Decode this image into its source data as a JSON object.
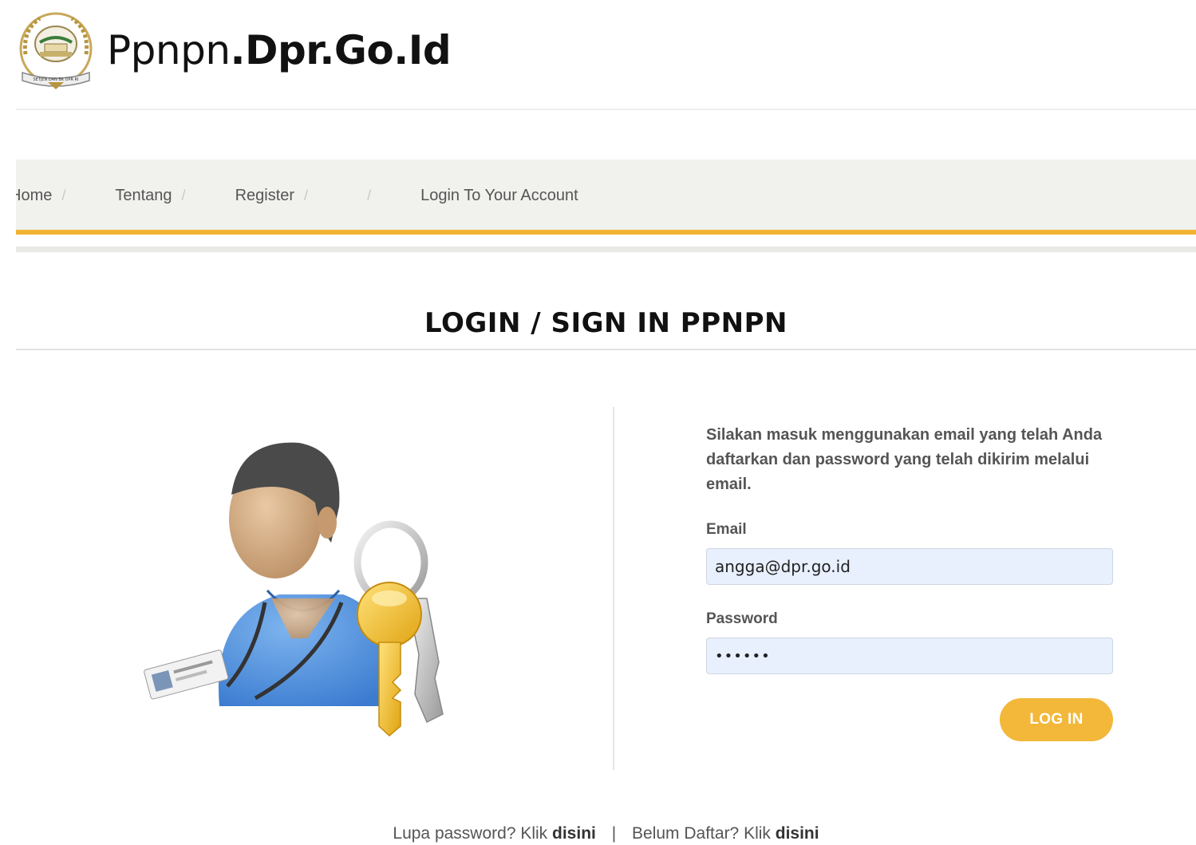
{
  "header": {
    "title_light": "Ppnpn",
    "title_bold": ".Dpr.Go.Id",
    "logo_text": "SETJEN DAN BK DPR RI"
  },
  "nav": {
    "items": [
      "Home",
      "Tentang",
      "Register",
      "",
      "Login To Your Account"
    ],
    "separator": "/"
  },
  "page_title": "LOGIN / SIGN IN PPNPN",
  "form": {
    "intro": "Silakan masuk menggunakan email yang telah Anda daftarkan dan password yang telah dikirim melalui email.",
    "email_label": "Email",
    "email_value": "angga@dpr.go.id",
    "password_label": "Password",
    "password_value": "••••••",
    "login_button": "LOG IN"
  },
  "footer": {
    "forgot_text": "Lupa password? Klik ",
    "forgot_link": "disini",
    "separator": "|",
    "register_text": "Belum Daftar? Klik ",
    "register_link": "disini"
  },
  "colors": {
    "accent": "#f2b233",
    "nav_bg": "#f1f2ee",
    "input_bg": "#e8f0fe"
  },
  "icons": {
    "logo": "dpr-emblem-icon",
    "illustration": "user-with-keys-icon"
  }
}
